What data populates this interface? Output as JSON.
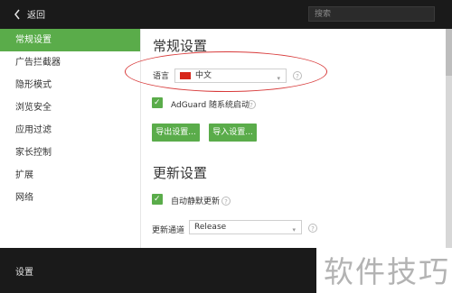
{
  "topbar": {
    "back_label": "返回",
    "search_placeholder": "搜索"
  },
  "sidebar": {
    "items": [
      {
        "label": "常规设置",
        "active": true
      },
      {
        "label": "广告拦截器"
      },
      {
        "label": "隐形模式"
      },
      {
        "label": "浏览安全"
      },
      {
        "label": "应用过滤"
      },
      {
        "label": "家长控制"
      },
      {
        "label": "扩展"
      },
      {
        "label": "网络"
      }
    ]
  },
  "general": {
    "title": "常规设置",
    "language_label": "语言",
    "language_value": "中文",
    "help_symbol": "?",
    "autostart_label": "AdGuard 随系统启动",
    "autostart_checked": true,
    "export_button": "导出设置...",
    "import_button": "导入设置..."
  },
  "update": {
    "title": "更新设置",
    "auto_update_label": "自动静默更新",
    "auto_update_checked": true,
    "channel_label": "更新通道",
    "channel_value": "Release"
  },
  "bottom": {
    "label": "设置"
  },
  "watermark": {
    "text": "软件技巧"
  },
  "colors": {
    "accent": "#5aac4a",
    "annotation": "#d83a3a"
  }
}
